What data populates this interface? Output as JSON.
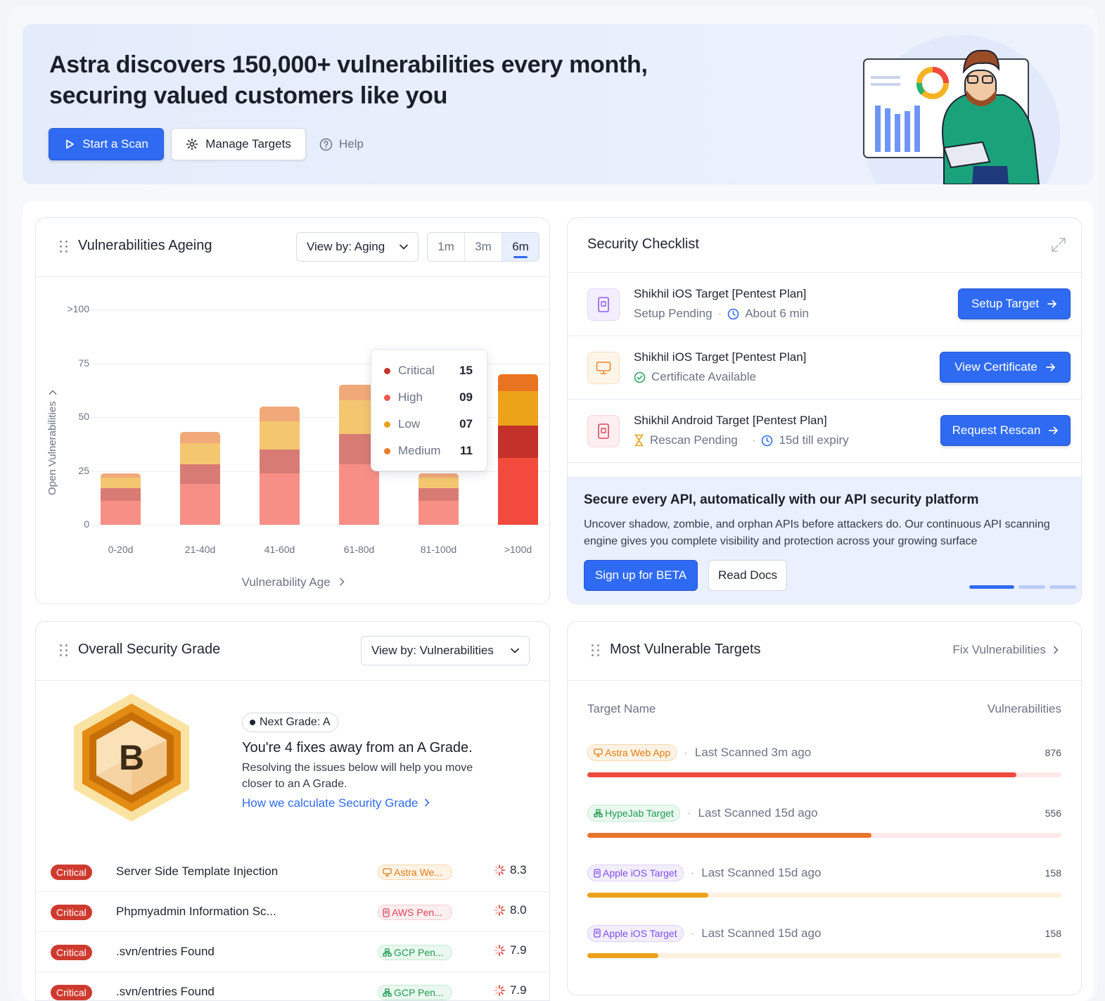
{
  "hero": {
    "headline": "Astra discovers 150,000+ vulnerabilities every month, securing valued customers like you",
    "start_scan_label": "Start a Scan",
    "manage_targets_label": "Manage Targets",
    "help_label": "Help"
  },
  "ageing": {
    "title": "Vulnerabilities Ageing",
    "view_by": "View by: Aging",
    "ranges": [
      "1m",
      "3m",
      "6m"
    ],
    "active_range": "6m",
    "x_label": "Vulnerability Age",
    "y_label": "Open Vulnerabilities",
    "tooltip": [
      {
        "label": "Critical",
        "value": "15",
        "color": "#c4332a"
      },
      {
        "label": "High",
        "value": "09",
        "color": "#ef5a4f"
      },
      {
        "label": "Low",
        "value": "07",
        "color": "#e9a11c"
      },
      {
        "label": "Medium",
        "value": "11",
        "color": "#ec7a28"
      }
    ]
  },
  "chart_data": {
    "type": "bar",
    "stacked": true,
    "categories": [
      "0-20d",
      "21-40d",
      "41-60d",
      "61-80d",
      "81-100d",
      ">100d"
    ],
    "y_tick_labels": [
      ">100",
      "75",
      "50",
      "25",
      "0"
    ],
    "ylim": [
      0,
      100
    ],
    "series": [
      {
        "name": "High",
        "color": "#f88f87",
        "values": [
          11,
          19,
          24,
          28,
          11,
          31
        ]
      },
      {
        "name": "Critical",
        "color": "#d97b75",
        "values": [
          6,
          9,
          11,
          14,
          6,
          15
        ]
      },
      {
        "name": "Low",
        "color": "#f3c66f",
        "values": [
          5,
          10,
          13,
          16,
          5,
          16
        ]
      },
      {
        "name": "Medium",
        "color": "#f1a97a",
        "values": [
          2,
          5,
          7,
          7,
          2,
          8
        ]
      }
    ],
    "highlighted_category": ">100d",
    "highlight_colors": [
      "#f24a3d",
      "#c4312a",
      "#eca31a",
      "#ea7322"
    ],
    "xlabel": "Vulnerability Age",
    "ylabel": "Open Vulnerabilities"
  },
  "checklist": {
    "title": "Security Checklist",
    "items": [
      {
        "title": "Shikhil iOS Target [Pentest Plan]",
        "status": "Setup Pending",
        "meta": "About 6 min",
        "button": "Setup Target"
      },
      {
        "title": "Shikhil iOS Target [Pentest Plan]",
        "status": "Certificate Available",
        "meta": "",
        "button": "View Certificate"
      },
      {
        "title": "Shikhil Android Target [Pentest Plan]",
        "status": "Rescan Pending",
        "meta": "15d till expiry",
        "button": "Request Rescan"
      }
    ],
    "promo": {
      "title": "Secure every API, automatically with our API security platform",
      "text": "Uncover shadow, zombie, and orphan APIs before attackers do. Our continuous API scanning engine gives you complete visibility and protection across your growing surface",
      "primary": "Sign up for BETA",
      "secondary": "Read Docs"
    }
  },
  "grade": {
    "title": "Overall Security Grade",
    "view_by": "View by: Vulnerabilities",
    "letter": "B",
    "next_grade": "Next Grade: A",
    "headline": "You're 4 fixes away from an A Grade.",
    "description": "Resolving the issues below will help you move closer to an A Grade.",
    "link": "How we calculate Security Grade",
    "vulns": [
      {
        "severity": "Critical",
        "name": "Server Side Template Injection",
        "target": "Astra We...",
        "target_kind": "web",
        "score": "8.3"
      },
      {
        "severity": "Critical",
        "name": "Phpmyadmin Information Sc...",
        "target": "AWS Pen...",
        "target_kind": "aws",
        "score": "8.0"
      },
      {
        "severity": "Critical",
        "name": ".svn/entries Found",
        "target": "GCP Pen...",
        "target_kind": "gcp",
        "score": "7.9"
      },
      {
        "severity": "Critical",
        "name": ".svn/entries Found",
        "target": "GCP Pen...",
        "target_kind": "gcp",
        "score": "7.9"
      }
    ]
  },
  "targets": {
    "title": "Most Vulnerable Targets",
    "action": "Fix Vulnerabilities",
    "col_name": "Target Name",
    "col_vulns": "Vulnerabilities",
    "rows": [
      {
        "name": "Astra Web App",
        "kind": "web",
        "scanned": "Last Scanned 3m ago",
        "count": "876",
        "fraction": 0.905,
        "color": "#ef4a40",
        "track": "#fde9e7"
      },
      {
        "name": "HypeJab Target",
        "kind": "gcp",
        "scanned": "Last Scanned 15d ago",
        "count": "556",
        "fraction": 0.6,
        "color": "#e8742a",
        "track": "#fde9e7"
      },
      {
        "name": "Apple iOS Target",
        "kind": "ios",
        "scanned": "Last Scanned 15d ago",
        "count": "158",
        "fraction": 0.255,
        "color": "#eca31a",
        "track": "#fdf1de"
      },
      {
        "name": "Apple iOS Target",
        "kind": "ios",
        "scanned": "Last Scanned 15d ago",
        "count": "158",
        "fraction": 0.15,
        "color": "#eca31a",
        "track": "#fdf1de"
      }
    ]
  }
}
